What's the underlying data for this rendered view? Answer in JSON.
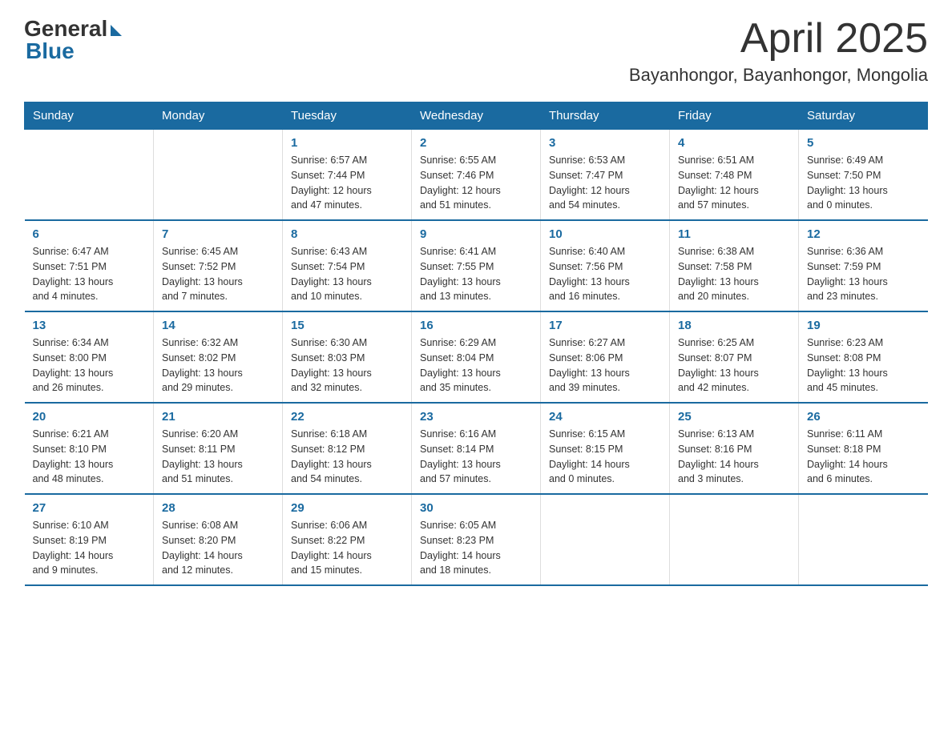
{
  "logo": {
    "general": "General",
    "blue": "Blue"
  },
  "title": "April 2025",
  "subtitle": "Bayanhongor, Bayanhongor, Mongolia",
  "weekdays": [
    "Sunday",
    "Monday",
    "Tuesday",
    "Wednesday",
    "Thursday",
    "Friday",
    "Saturday"
  ],
  "weeks": [
    [
      {
        "day": "",
        "info": ""
      },
      {
        "day": "",
        "info": ""
      },
      {
        "day": "1",
        "info": "Sunrise: 6:57 AM\nSunset: 7:44 PM\nDaylight: 12 hours\nand 47 minutes."
      },
      {
        "day": "2",
        "info": "Sunrise: 6:55 AM\nSunset: 7:46 PM\nDaylight: 12 hours\nand 51 minutes."
      },
      {
        "day": "3",
        "info": "Sunrise: 6:53 AM\nSunset: 7:47 PM\nDaylight: 12 hours\nand 54 minutes."
      },
      {
        "day": "4",
        "info": "Sunrise: 6:51 AM\nSunset: 7:48 PM\nDaylight: 12 hours\nand 57 minutes."
      },
      {
        "day": "5",
        "info": "Sunrise: 6:49 AM\nSunset: 7:50 PM\nDaylight: 13 hours\nand 0 minutes."
      }
    ],
    [
      {
        "day": "6",
        "info": "Sunrise: 6:47 AM\nSunset: 7:51 PM\nDaylight: 13 hours\nand 4 minutes."
      },
      {
        "day": "7",
        "info": "Sunrise: 6:45 AM\nSunset: 7:52 PM\nDaylight: 13 hours\nand 7 minutes."
      },
      {
        "day": "8",
        "info": "Sunrise: 6:43 AM\nSunset: 7:54 PM\nDaylight: 13 hours\nand 10 minutes."
      },
      {
        "day": "9",
        "info": "Sunrise: 6:41 AM\nSunset: 7:55 PM\nDaylight: 13 hours\nand 13 minutes."
      },
      {
        "day": "10",
        "info": "Sunrise: 6:40 AM\nSunset: 7:56 PM\nDaylight: 13 hours\nand 16 minutes."
      },
      {
        "day": "11",
        "info": "Sunrise: 6:38 AM\nSunset: 7:58 PM\nDaylight: 13 hours\nand 20 minutes."
      },
      {
        "day": "12",
        "info": "Sunrise: 6:36 AM\nSunset: 7:59 PM\nDaylight: 13 hours\nand 23 minutes."
      }
    ],
    [
      {
        "day": "13",
        "info": "Sunrise: 6:34 AM\nSunset: 8:00 PM\nDaylight: 13 hours\nand 26 minutes."
      },
      {
        "day": "14",
        "info": "Sunrise: 6:32 AM\nSunset: 8:02 PM\nDaylight: 13 hours\nand 29 minutes."
      },
      {
        "day": "15",
        "info": "Sunrise: 6:30 AM\nSunset: 8:03 PM\nDaylight: 13 hours\nand 32 minutes."
      },
      {
        "day": "16",
        "info": "Sunrise: 6:29 AM\nSunset: 8:04 PM\nDaylight: 13 hours\nand 35 minutes."
      },
      {
        "day": "17",
        "info": "Sunrise: 6:27 AM\nSunset: 8:06 PM\nDaylight: 13 hours\nand 39 minutes."
      },
      {
        "day": "18",
        "info": "Sunrise: 6:25 AM\nSunset: 8:07 PM\nDaylight: 13 hours\nand 42 minutes."
      },
      {
        "day": "19",
        "info": "Sunrise: 6:23 AM\nSunset: 8:08 PM\nDaylight: 13 hours\nand 45 minutes."
      }
    ],
    [
      {
        "day": "20",
        "info": "Sunrise: 6:21 AM\nSunset: 8:10 PM\nDaylight: 13 hours\nand 48 minutes."
      },
      {
        "day": "21",
        "info": "Sunrise: 6:20 AM\nSunset: 8:11 PM\nDaylight: 13 hours\nand 51 minutes."
      },
      {
        "day": "22",
        "info": "Sunrise: 6:18 AM\nSunset: 8:12 PM\nDaylight: 13 hours\nand 54 minutes."
      },
      {
        "day": "23",
        "info": "Sunrise: 6:16 AM\nSunset: 8:14 PM\nDaylight: 13 hours\nand 57 minutes."
      },
      {
        "day": "24",
        "info": "Sunrise: 6:15 AM\nSunset: 8:15 PM\nDaylight: 14 hours\nand 0 minutes."
      },
      {
        "day": "25",
        "info": "Sunrise: 6:13 AM\nSunset: 8:16 PM\nDaylight: 14 hours\nand 3 minutes."
      },
      {
        "day": "26",
        "info": "Sunrise: 6:11 AM\nSunset: 8:18 PM\nDaylight: 14 hours\nand 6 minutes."
      }
    ],
    [
      {
        "day": "27",
        "info": "Sunrise: 6:10 AM\nSunset: 8:19 PM\nDaylight: 14 hours\nand 9 minutes."
      },
      {
        "day": "28",
        "info": "Sunrise: 6:08 AM\nSunset: 8:20 PM\nDaylight: 14 hours\nand 12 minutes."
      },
      {
        "day": "29",
        "info": "Sunrise: 6:06 AM\nSunset: 8:22 PM\nDaylight: 14 hours\nand 15 minutes."
      },
      {
        "day": "30",
        "info": "Sunrise: 6:05 AM\nSunset: 8:23 PM\nDaylight: 14 hours\nand 18 minutes."
      },
      {
        "day": "",
        "info": ""
      },
      {
        "day": "",
        "info": ""
      },
      {
        "day": "",
        "info": ""
      }
    ]
  ]
}
